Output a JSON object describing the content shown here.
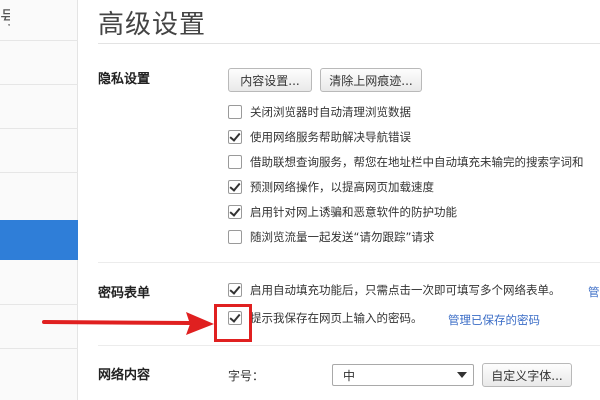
{
  "sidebar": {
    "frag_top": "号"
  },
  "title": "高级设置",
  "privacy": {
    "label": "隐私设置",
    "content_settings_btn": "内容设置...",
    "clear_btn": "清除上网痕迹...",
    "options": [
      {
        "text": "关闭浏览器时自动清理浏览数据",
        "checked": false
      },
      {
        "text": "使用网络服务帮助解决导航错误",
        "checked": true
      },
      {
        "text": "借助联想查询服务，帮您在地址栏中自动填充未输完的搜索字词和",
        "checked": false
      },
      {
        "text": "预测网络操作，以提高网页加载速度",
        "checked": true
      },
      {
        "text": "启用针对网上诱骗和恶意软件的防护功能",
        "checked": true
      },
      {
        "text": "随浏览流量一起发送“请勿跟踪”请求",
        "checked": false
      }
    ]
  },
  "password": {
    "label": "密码表单",
    "options": [
      {
        "text": "启用自动填充功能后，只需点击一次即可填写多个网络表单。",
        "checked": true
      },
      {
        "text": "提示我保存在网页上输入的密码。",
        "checked": true
      }
    ],
    "link_cut": "管",
    "manage_link": "管理已保存的密码"
  },
  "web_content": {
    "label": "网络内容",
    "font_size_label": "字号：",
    "font_size_value": "中",
    "custom_font_btn": "自定义字体..."
  },
  "colors": {
    "accent": "#2f7ed8",
    "annotation": "#e02020"
  }
}
